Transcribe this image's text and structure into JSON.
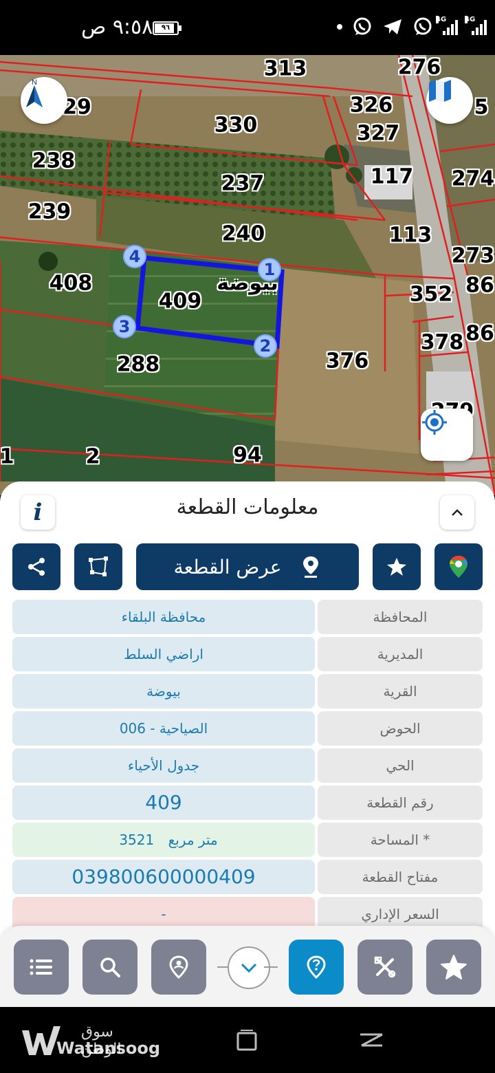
{
  "status_bar": {
    "time": "٩:٥٨ ص",
    "battery": "٩٦",
    "network_1": "4G",
    "network_2": "4G"
  },
  "map": {
    "parcels": [
      {
        "label": "313"
      },
      {
        "label": "276"
      },
      {
        "label": "29"
      },
      {
        "label": "5"
      },
      {
        "label": "330"
      },
      {
        "label": "326"
      },
      {
        "label": "327"
      },
      {
        "label": "238"
      },
      {
        "label": "237"
      },
      {
        "label": "117"
      },
      {
        "label": "274"
      },
      {
        "label": "239"
      },
      {
        "label": "240"
      },
      {
        "label": "113"
      },
      {
        "label": "273"
      },
      {
        "label": "408"
      },
      {
        "label": "409"
      },
      {
        "label": "352"
      },
      {
        "label": "86"
      },
      {
        "label": "86"
      },
      {
        "label": "378"
      },
      {
        "label": "288"
      },
      {
        "label": "376"
      },
      {
        "label": "279"
      },
      {
        "label": "1"
      },
      {
        "label": "2"
      },
      {
        "label": "94"
      }
    ],
    "vertices": [
      "1",
      "2",
      "3",
      "4"
    ],
    "village_label": "بيوضة",
    "selected_color": "#1515e0",
    "boundary_color": "#e02020"
  },
  "panel": {
    "title": "معلومات القطعة",
    "info_label": "i",
    "show_parcel_label": "عرض القطعة",
    "rows": [
      {
        "label": "المحافظة",
        "value": "محافظة البلقاء"
      },
      {
        "label": "المديرية",
        "value": "اراضي السلط"
      },
      {
        "label": "القرية",
        "value": "بيوضة"
      },
      {
        "label": "الحوض",
        "value": "الصياحية - 006"
      },
      {
        "label": "الحي",
        "value": "جدول الأحياء"
      },
      {
        "label": "رقم القطعة",
        "value": "409"
      },
      {
        "label": "المساحة *",
        "value": "3521",
        "unit": "متر مربع"
      },
      {
        "label": "مفتاح القطعة",
        "value": "039800600000409"
      },
      {
        "label": "السعر الإداري",
        "value": "-"
      }
    ]
  },
  "watermark": {
    "arabic": "سوق الوطن",
    "english": "Watansoog"
  },
  "colors": {
    "primary": "#0d3b66",
    "active": "#0b8bc8",
    "nav_button": "#7e8192",
    "value_text": "#1a7bb0"
  }
}
